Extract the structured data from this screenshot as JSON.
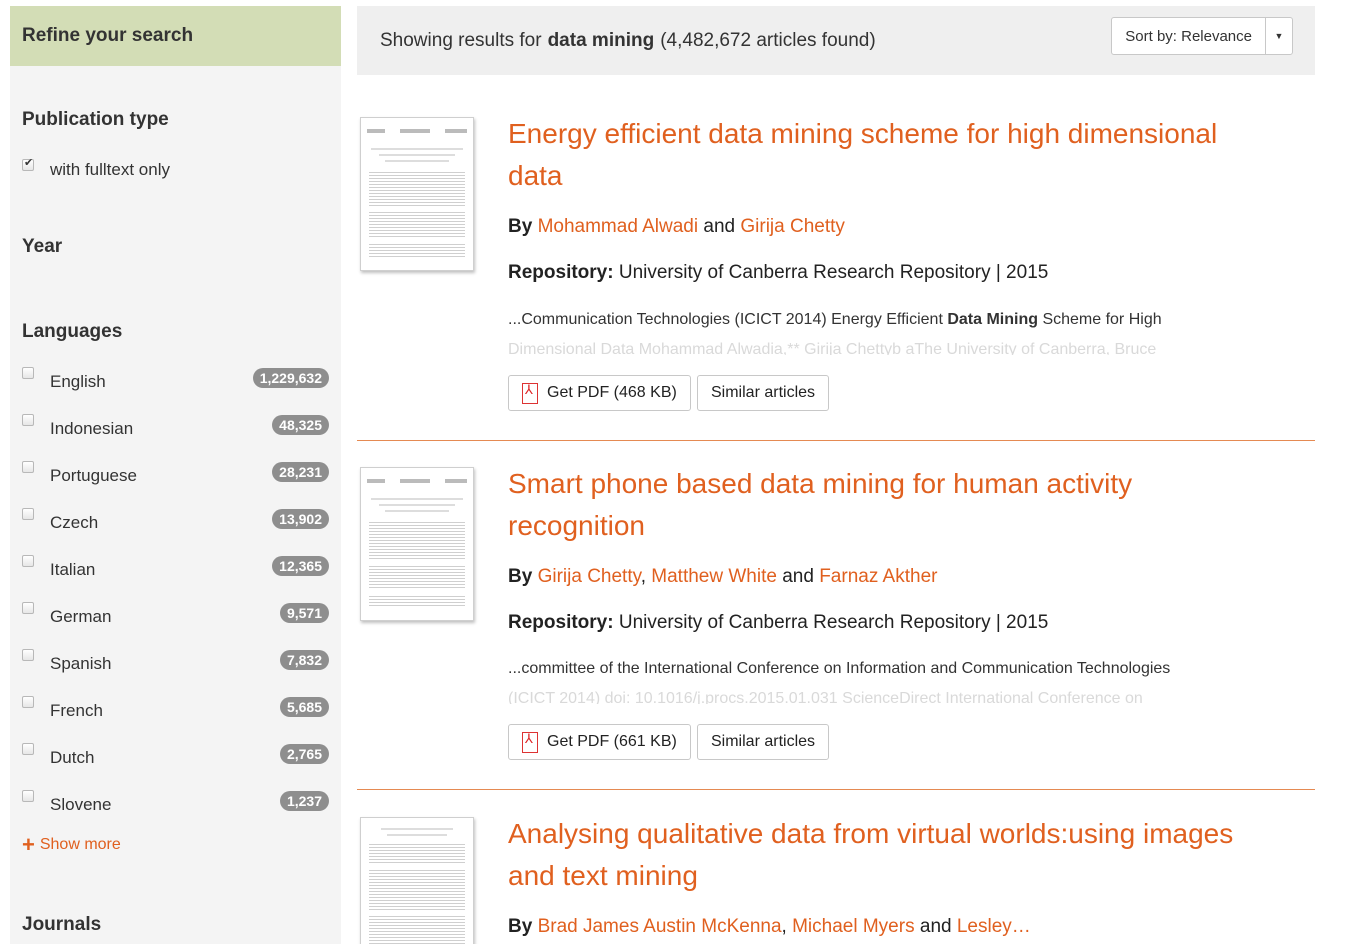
{
  "sidebar": {
    "header": "Refine your search",
    "publication_type": {
      "title": "Publication type",
      "option_label": "with fulltext only"
    },
    "year_title": "Year",
    "languages": {
      "title": "Languages",
      "items": [
        {
          "label": "English",
          "count": "1,229,632"
        },
        {
          "label": "Indonesian",
          "count": "48,325"
        },
        {
          "label": "Portuguese",
          "count": "28,231"
        },
        {
          "label": "Czech",
          "count": "13,902"
        },
        {
          "label": "Italian",
          "count": "12,365"
        },
        {
          "label": "German",
          "count": "9,571"
        },
        {
          "label": "Spanish",
          "count": "7,832"
        },
        {
          "label": "French",
          "count": "5,685"
        },
        {
          "label": "Dutch",
          "count": "2,765"
        },
        {
          "label": "Slovene",
          "count": "1,237"
        }
      ]
    },
    "show_more": "Show more",
    "journals_title": "Journals"
  },
  "results_header": {
    "prefix": "Showing results for",
    "query": "data mining",
    "count_text": "(4,482,672 articles found)",
    "sort_label": "Sort by: Relevance"
  },
  "results": [
    {
      "title": "Energy efficient data mining scheme for high dimensional data",
      "by": "By",
      "authors": [
        "Mohammad Alwadi",
        "Girija Chetty"
      ],
      "repo_label": "Repository:",
      "repo_value": "University of Canberra Research Repository | 2015",
      "snippet_pre": "...Communication Technologies (ICICT 2014) Energy Efficient ",
      "snippet_bold": "Data Mining",
      "snippet_post": " Scheme for High",
      "snippet_fade": "Dimensional Data Mohammad Alwadia,** Girija Chettyb aThe University of Canberra, Bruce",
      "pdf_label": "Get PDF (468 KB)",
      "similar_label": "Similar articles"
    },
    {
      "title": "Smart phone based data mining for human activity recognition",
      "by": "By",
      "authors": [
        "Girija Chetty",
        "Matthew White",
        "Farnaz Akther"
      ],
      "repo_label": "Repository:",
      "repo_value": "University of Canberra Research Repository | 2015",
      "snippet_pre": "...committee of the International Conference on Information and Communication Technologies",
      "snippet_bold": "",
      "snippet_post": "",
      "snippet_fade": "(ICICT 2014) doi: 10.1016/j.procs.2015.01.031 ScienceDirect International Conference on",
      "pdf_label": "Get PDF (661 KB)",
      "similar_label": "Similar articles"
    },
    {
      "title": "Analysing qualitative data from virtual worlds:using images and text mining",
      "by": "By",
      "authors": [
        "Brad James Austin McKenna",
        "Michael Myers",
        "Lesley…"
      ]
    }
  ],
  "conjunctions": {
    "and": "and",
    "comma": ","
  },
  "colors": {
    "accent": "#e0601f",
    "refine_bg": "#d3ddb6",
    "badge": "#8e8e8e"
  }
}
